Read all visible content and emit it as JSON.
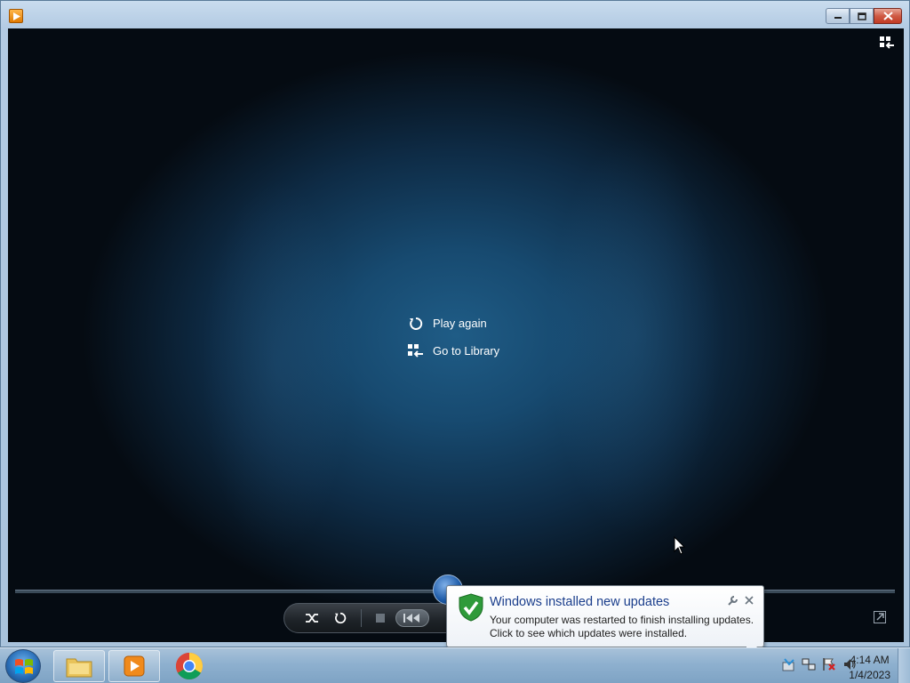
{
  "window": {
    "title": "",
    "controls": [
      "minimize",
      "maximize",
      "close"
    ]
  },
  "player": {
    "menu": {
      "play_again": "Play again",
      "go_to_library": "Go to Library"
    },
    "controls": [
      "shuffle",
      "repeat",
      "stop",
      "previous",
      "play"
    ]
  },
  "notification": {
    "title": "Windows installed new updates",
    "line1": "Your computer was restarted to finish installing updates.",
    "line2": "Click to see which updates were installed."
  },
  "taskbar": {
    "items": [
      "windows-explorer",
      "windows-media-player",
      "google-chrome"
    ],
    "tray_icons": [
      "action-center-icon",
      "network-icon",
      "flag-error-icon",
      "volume-icon"
    ],
    "time": "4:14 AM",
    "date": "1/4/2023"
  },
  "colors": {
    "video_center": "#1f5c86",
    "balloon_title": "#1a3e8c",
    "taskbar": "#8eb0cf"
  }
}
